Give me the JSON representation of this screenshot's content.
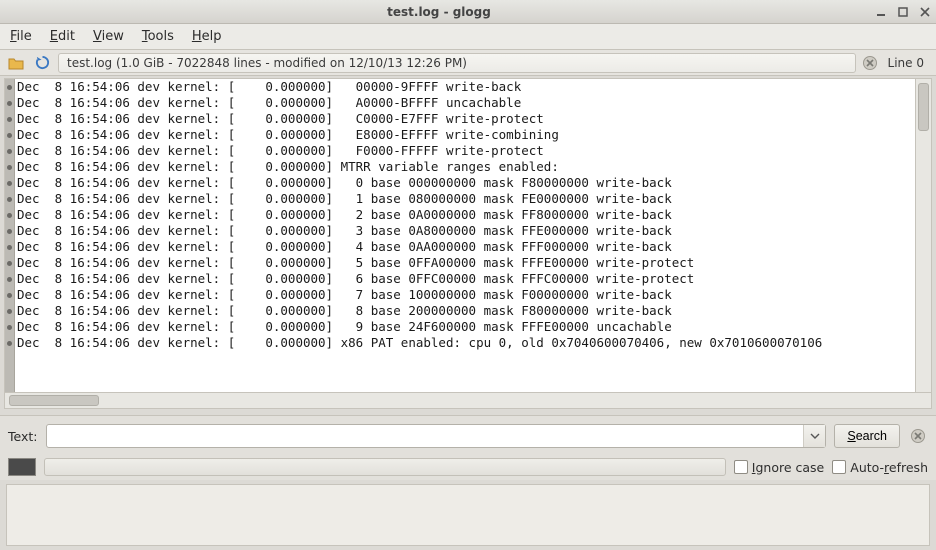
{
  "titlebar": {
    "title": "test.log - glogg"
  },
  "menus": {
    "file": "File",
    "edit": "Edit",
    "view": "View",
    "tools": "Tools",
    "help": "Help"
  },
  "toolbar": {
    "file_info": "test.log (1.0 GiB - 7022848 lines - modified on 12/10/13 12:26 PM)",
    "line_label": "Line 0"
  },
  "search": {
    "label": "Text:",
    "value": "",
    "placeholder": "",
    "button": "Search",
    "ignore_case": "Ignore case",
    "auto_refresh": "Auto-refresh"
  },
  "log_lines": [
    "Dec  8 16:54:06 dev kernel: [    0.000000]   00000-9FFFF write-back",
    "Dec  8 16:54:06 dev kernel: [    0.000000]   A0000-BFFFF uncachable",
    "Dec  8 16:54:06 dev kernel: [    0.000000]   C0000-E7FFF write-protect",
    "Dec  8 16:54:06 dev kernel: [    0.000000]   E8000-EFFFF write-combining",
    "Dec  8 16:54:06 dev kernel: [    0.000000]   F0000-FFFFF write-protect",
    "Dec  8 16:54:06 dev kernel: [    0.000000] MTRR variable ranges enabled:",
    "Dec  8 16:54:06 dev kernel: [    0.000000]   0 base 000000000 mask F80000000 write-back",
    "Dec  8 16:54:06 dev kernel: [    0.000000]   1 base 080000000 mask FE0000000 write-back",
    "Dec  8 16:54:06 dev kernel: [    0.000000]   2 base 0A0000000 mask FF8000000 write-back",
    "Dec  8 16:54:06 dev kernel: [    0.000000]   3 base 0A8000000 mask FFE000000 write-back",
    "Dec  8 16:54:06 dev kernel: [    0.000000]   4 base 0AA000000 mask FFF000000 write-back",
    "Dec  8 16:54:06 dev kernel: [    0.000000]   5 base 0FFA00000 mask FFFE00000 write-protect",
    "Dec  8 16:54:06 dev kernel: [    0.000000]   6 base 0FFC00000 mask FFFC00000 write-protect",
    "Dec  8 16:54:06 dev kernel: [    0.000000]   7 base 100000000 mask F00000000 write-back",
    "Dec  8 16:54:06 dev kernel: [    0.000000]   8 base 200000000 mask F80000000 write-back",
    "Dec  8 16:54:06 dev kernel: [    0.000000]   9 base 24F600000 mask FFFE00000 uncachable",
    "Dec  8 16:54:06 dev kernel: [    0.000000] x86 PAT enabled: cpu 0, old 0x7040600070406, new 0x7010600070106"
  ]
}
